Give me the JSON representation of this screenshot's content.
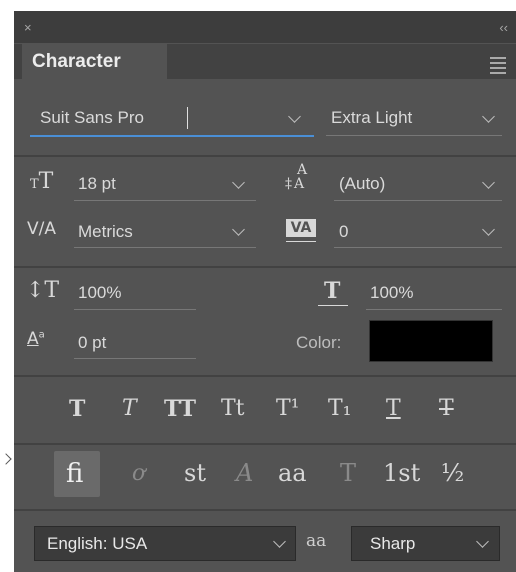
{
  "panel": {
    "tab_title": "Character",
    "close_glyph": "×",
    "collapse_glyph": "‹‹"
  },
  "font": {
    "family": "Suit Sans Pro",
    "style": "Extra Light"
  },
  "metrics": {
    "size": "18 pt",
    "leading": "(Auto)",
    "kerning": "Metrics",
    "tracking": "0",
    "vertical_scale": "100%",
    "horizontal_scale": "100%",
    "baseline_shift": "0 pt",
    "color_label": "Color:",
    "color_value": "#000000"
  },
  "type_styles": [
    "T",
    "T",
    "TT",
    "Tt",
    "T¹",
    "T₁",
    "T",
    "T"
  ],
  "opentype": [
    "fi",
    "ơ",
    "st",
    "A",
    "aa",
    "T",
    "1st",
    "½"
  ],
  "language": {
    "value": "English: USA",
    "aa_glyph": "aa",
    "antialias": "Sharp"
  },
  "icons": {
    "size": "size-icon",
    "leading": "leading-icon",
    "kerning": "kerning-icon",
    "tracking": "tracking-icon",
    "vscale": "vertical-scale-icon",
    "hscale": "horizontal-scale-icon",
    "baseline": "baseline-shift-icon"
  }
}
